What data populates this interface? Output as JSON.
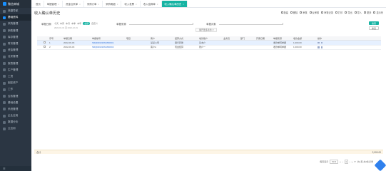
{
  "sidebar": {
    "logo_text": "微信商城",
    "items": [
      {
        "label": "快捷导航",
        "active": false
      },
      {
        "label": "基础资料",
        "active": true
      },
      {
        "label": "采购管理",
        "active": false
      },
      {
        "label": "销售管理",
        "active": false
      },
      {
        "label": "库存管理",
        "active": false
      },
      {
        "label": "财务管理",
        "active": false
      },
      {
        "label": "资金管理",
        "active": false
      },
      {
        "label": "往来管理",
        "active": false
      },
      {
        "label": "报表管理",
        "active": false
      },
      {
        "label": "生产管理",
        "active": false
      },
      {
        "label": "工资",
        "active": false
      },
      {
        "label": "固定资产",
        "active": false
      },
      {
        "label": "工作",
        "active": false
      },
      {
        "label": "应收管理",
        "active": false
      },
      {
        "label": "基础设置",
        "active": false
      },
      {
        "label": "系统管理",
        "active": false
      },
      {
        "label": "企业应用",
        "active": false
      },
      {
        "label": "数据分析",
        "active": false
      },
      {
        "label": "云应用",
        "active": false
      }
    ],
    "footer_icon": "menu-collapse-icon"
  },
  "tabs": [
    {
      "label": "首页",
      "active": false
    },
    {
      "label": "单据管理",
      "active": false
    },
    {
      "label": "资金往来单",
      "active": false
    },
    {
      "label": "采购订单",
      "active": false
    },
    {
      "label": "采购明细",
      "active": false
    },
    {
      "label": "收入发票",
      "active": false
    },
    {
      "label": "收入结算单",
      "active": false
    },
    {
      "label": "收入确认单历史",
      "active": true
    }
  ],
  "page": {
    "title": "收入确认单历史"
  },
  "toolbar": [
    {
      "label": "新建",
      "icon": "add-icon"
    },
    {
      "label": "删除",
      "icon": "delete-icon"
    },
    {
      "label": "审核",
      "icon": "audit-icon"
    },
    {
      "label": "反审核",
      "icon": "unaudit-icon"
    },
    {
      "label": "审核记录",
      "icon": "record-icon"
    },
    {
      "label": "打印",
      "icon": "print-icon"
    },
    {
      "label": "导出",
      "icon": "export-icon"
    },
    {
      "label": "导入",
      "icon": "import-icon"
    },
    {
      "label": "更多",
      "icon": "more-icon"
    },
    {
      "label": "显示列",
      "icon": "columns-icon"
    }
  ],
  "filters": {
    "date_label": "单据日期",
    "date_options": [
      "今天",
      "本周",
      "本月",
      "本季",
      "本年"
    ],
    "date_pill": "全部",
    "date_custom": "自定义",
    "date_range": "2022-01-01 至 2022-12-31",
    "source_label": "单据来源",
    "source_placeholder": "",
    "client_label": "单据对象",
    "client_placeholder": "",
    "expand_label": "展开更多条件 ▾"
  },
  "side_buttons": {
    "search": "搜索",
    "reset": "重置"
  },
  "table": {
    "headers": [
      "",
      "",
      "序号",
      "单据日期",
      "单据编号",
      "项目",
      "客户",
      "结算方式",
      "收款账户",
      "业务员",
      "部门",
      "开票日期",
      "单据来源",
      "收款金额",
      "",
      "操作"
    ],
    "rows": [
      {
        "index": "1",
        "date": "2022-06-18",
        "code": "SRQR2022061800001",
        "project": "",
        "client": "某某公司",
        "settle": "银行转账",
        "account": "基本户",
        "staff": "",
        "dept": "",
        "invoice_date": "",
        "source": "收款单转单据",
        "amount": "1,000.00",
        "selected": true
      },
      {
        "index": "2",
        "date": "2022-06-18",
        "code": "SRQR2022061800002",
        "project": "",
        "client": "客户A",
        "settle": "现金结算",
        "account": "账户一",
        "staff": "",
        "dept": "",
        "invoice_date": "",
        "source": "收款单转单据",
        "amount": "1,000.00",
        "selected": false
      }
    ]
  },
  "summary": {
    "label": "合计",
    "value": "2,000.00"
  },
  "pagination": {
    "page_size_label": "每页显示",
    "page_size": "50",
    "page": "1",
    "total": "共1页,共2条记录"
  }
}
